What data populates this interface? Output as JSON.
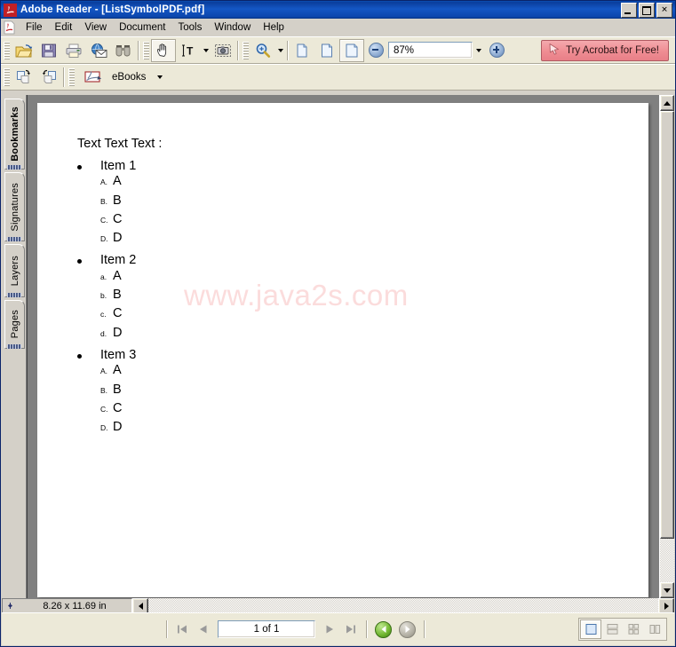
{
  "window": {
    "title": "Adobe Reader - [ListSymbolPDF.pdf]",
    "app_icon": "acrobat-icon",
    "controls": {
      "minimize": "_",
      "maximize": "□",
      "close": "✕"
    }
  },
  "menu": {
    "items": [
      {
        "label": "File"
      },
      {
        "label": "Edit"
      },
      {
        "label": "View"
      },
      {
        "label": "Document"
      },
      {
        "label": "Tools"
      },
      {
        "label": "Window"
      },
      {
        "label": "Help"
      }
    ]
  },
  "toolbar": {
    "file_group": [
      {
        "name": "open-button",
        "icon": "open-folder-icon",
        "label": "Open"
      },
      {
        "name": "save-button",
        "icon": "save-disk-icon",
        "label": "Save a Copy"
      },
      {
        "name": "print-button",
        "icon": "printer-icon",
        "label": "Print"
      },
      {
        "name": "email-button",
        "icon": "email-globe-icon",
        "label": "Email"
      },
      {
        "name": "search-button",
        "icon": "binoculars-icon",
        "label": "Search"
      }
    ],
    "tools_group": [
      {
        "name": "hand-tool",
        "icon": "hand-icon",
        "label": "Hand Tool",
        "active": true
      },
      {
        "name": "select-text-tool",
        "icon": "select-text-icon",
        "label": "Select Text"
      },
      {
        "name": "snapshot-tool",
        "icon": "camera-icon",
        "label": "Snapshot Tool"
      }
    ],
    "zoom_group": [
      {
        "name": "zoom-in-tool",
        "icon": "magnifier-icon",
        "label": "Zoom In Tool"
      }
    ],
    "view_group": [
      {
        "name": "actual-size-button",
        "icon": "page-icon",
        "label": "Actual Size"
      },
      {
        "name": "fit-page-button",
        "icon": "page-icon",
        "label": "Fit Page"
      },
      {
        "name": "fit-width-button",
        "icon": "page-icon",
        "label": "Fit Width",
        "active": true
      }
    ],
    "zoom_out_label": "−",
    "zoom_in_label": "+",
    "zoom_value": "87%",
    "acrobat_promo": {
      "label": "Try Acrobat for Free!",
      "icon": "cursor-arrow-icon",
      "color": "#ef8d93"
    }
  },
  "toolbar2": {
    "nav_group": [
      {
        "name": "previous-view-button",
        "icon": "page-back-icon",
        "label": "Previous View"
      },
      {
        "name": "next-view-button",
        "icon": "page-forward-icon",
        "label": "Next View"
      }
    ],
    "ebooks": {
      "label": "eBooks",
      "icon": "ebooks-icon"
    }
  },
  "sidebar": {
    "tabs": [
      {
        "label": "Bookmarks",
        "active": true
      },
      {
        "label": "Signatures",
        "active": false
      },
      {
        "label": "Layers",
        "active": false
      },
      {
        "label": "Pages",
        "active": false
      }
    ]
  },
  "document": {
    "heading": "Text Text Text :",
    "watermark": "www.java2s.com",
    "items": [
      {
        "bullet": "•",
        "label": "Item 1",
        "sub": [
          {
            "marker": "A.",
            "text": "A"
          },
          {
            "marker": "B.",
            "text": "B"
          },
          {
            "marker": "C.",
            "text": "C"
          },
          {
            "marker": "D.",
            "text": "D"
          }
        ]
      },
      {
        "bullet": "•",
        "label": "Item 2",
        "sub": [
          {
            "marker": "a.",
            "text": "A"
          },
          {
            "marker": "b.",
            "text": "B"
          },
          {
            "marker": "c.",
            "text": "C"
          },
          {
            "marker": "d.",
            "text": "D"
          }
        ]
      },
      {
        "bullet": "•",
        "label": "Item 3",
        "sub": [
          {
            "marker": "A.",
            "text": "A"
          },
          {
            "marker": "B.",
            "text": "B"
          },
          {
            "marker": "C.",
            "text": "C"
          },
          {
            "marker": "D.",
            "text": "D"
          }
        ]
      }
    ]
  },
  "statusbar": {
    "page_size": "8.26 x 11.69 in",
    "page_indicator": "1 of 1",
    "first_page_label": "First Page",
    "prev_page_label": "Previous Page",
    "next_page_label": "Next Page",
    "last_page_label": "Last Page",
    "back_label": "Go to Previous View",
    "forward_label": "Go to Next View",
    "layout_buttons": [
      {
        "name": "single-page-layout",
        "label": "Single Page",
        "active": true
      },
      {
        "name": "continuous-layout",
        "label": "Continuous",
        "active": false
      },
      {
        "name": "continuous-facing-layout",
        "label": "Continuous - Facing",
        "active": false
      },
      {
        "name": "facing-layout",
        "label": "Facing",
        "active": false
      }
    ]
  }
}
